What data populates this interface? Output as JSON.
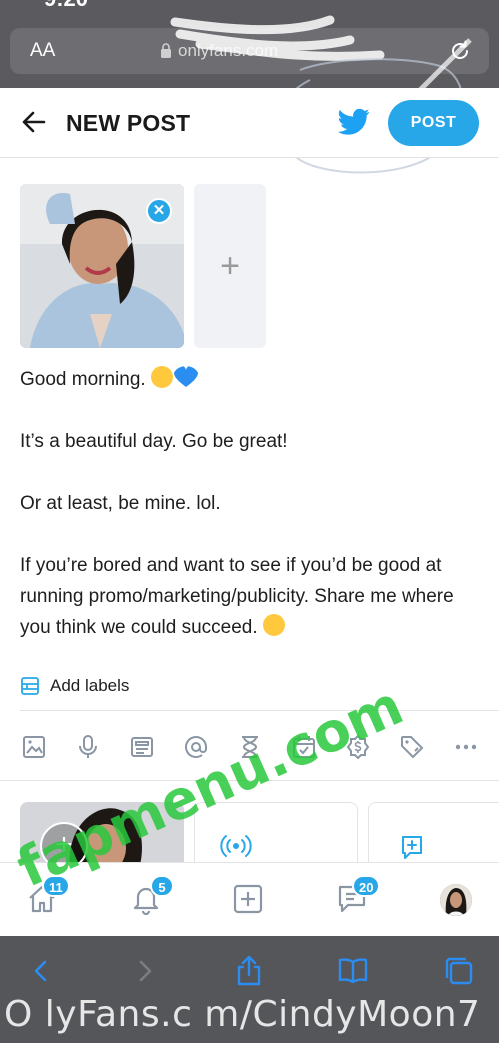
{
  "browser": {
    "font_size_label": "AA",
    "url_text": "onlyfans.com"
  },
  "header": {
    "title": "NEW POST",
    "post_label": "POST"
  },
  "post": {
    "line1": "Good morning.",
    "line2": "It’s a beautiful day. Go be great!",
    "line3": "Or at least, be mine. lol.",
    "line4": "If you’re bored and want to see if you’d be good at running promo/marketing/publicity. Share me where you think we could succeed."
  },
  "labels": {
    "add_labels": "Add labels"
  },
  "toolbar": {
    "icons": [
      "image-icon",
      "microphone-icon",
      "poll-icon",
      "mention-icon",
      "hourglass-icon",
      "calendar-icon",
      "price-icon",
      "tag-icon",
      "more-icon"
    ]
  },
  "nav": {
    "home_badge": "11",
    "notifications_badge": "5",
    "messages_badge": "20"
  },
  "watermark": {
    "site": "fapmenu.com",
    "url": "O lyFans.c m/CindyMoon7"
  },
  "colors": {
    "accent": "#27a7e7",
    "browser_chrome": "#5b5b5f"
  }
}
